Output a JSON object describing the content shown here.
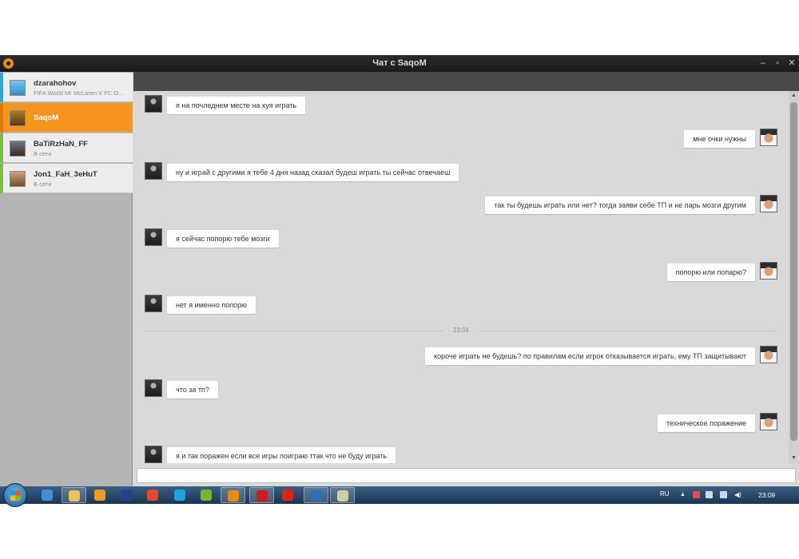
{
  "window": {
    "title": "Чат с SaqoM",
    "colors": {
      "accent": "#f7941d",
      "titlebar": "#1a1a1a"
    }
  },
  "contacts": [
    {
      "name": "dzarahohov",
      "status": "FIFA World Mr McLaren V FC O...",
      "bar_color": "#2aa7e0"
    },
    {
      "name": "SaqoM",
      "status": "",
      "bar_color": "#e07a00"
    },
    {
      "name": "BaTiRzHaN_FF",
      "status": "В сети",
      "bar_color": "#7ac142"
    },
    {
      "name": "Jon1_FaH_3eHuT",
      "status": "В сети",
      "bar_color": "#7ac142"
    }
  ],
  "messages": [
    {
      "side": "in",
      "text": "я на почледнем месте на хуя играть"
    },
    {
      "side": "out",
      "text": "мне очки нужны"
    },
    {
      "side": "in",
      "text": "ну  и играй с другими я тебе 4 дня назад сказал будеш играть ты сейчас отвечаеш"
    },
    {
      "side": "out",
      "text": "так ты будешь играть или нет? тогда заяви себе ТП и не парь мозги другим"
    },
    {
      "side": "in",
      "text": "я сейчас попорю тебе мозги"
    },
    {
      "side": "out",
      "text": "попорю или попарю?"
    },
    {
      "side": "in",
      "text": "нет я именно попорю"
    },
    {
      "side": "out",
      "text": "короче играть не будешь? по правилам если игрок отказывается играть, ему ТП защитывают"
    },
    {
      "side": "in",
      "text": "что за тп?"
    },
    {
      "side": "out",
      "text": "техническое поражение"
    },
    {
      "side": "in",
      "text": "я и так поражен если все игры поиграю ттак что не буду играть"
    }
  ],
  "time_separator": "23:04",
  "input": {
    "value": "",
    "placeholder": ""
  },
  "taskbar": {
    "apps": [
      {
        "icon": "ie-icon",
        "color": "#3d8fd8"
      },
      {
        "icon": "explorer-icon",
        "color": "#e8c45a"
      },
      {
        "icon": "media-player-icon",
        "color": "#f29a1f"
      },
      {
        "icon": "eye-app-icon",
        "color": "#2b3f8c"
      },
      {
        "icon": "chrome-icon",
        "color": "#e14a2d"
      },
      {
        "icon": "skype-icon",
        "color": "#19a6e0"
      },
      {
        "icon": "utorrent-icon",
        "color": "#77b82a"
      },
      {
        "icon": "origin-icon",
        "color": "#f08a00"
      },
      {
        "icon": "opera-icon",
        "color": "#d21a1a"
      },
      {
        "icon": "yandex-icon",
        "color": "#e62117"
      },
      {
        "icon": "network-app-icon",
        "color": "#2d6fb6"
      },
      {
        "icon": "pictures-icon",
        "color": "#c9d39a"
      }
    ],
    "tray_lang": "RU",
    "clock": "23:09"
  }
}
